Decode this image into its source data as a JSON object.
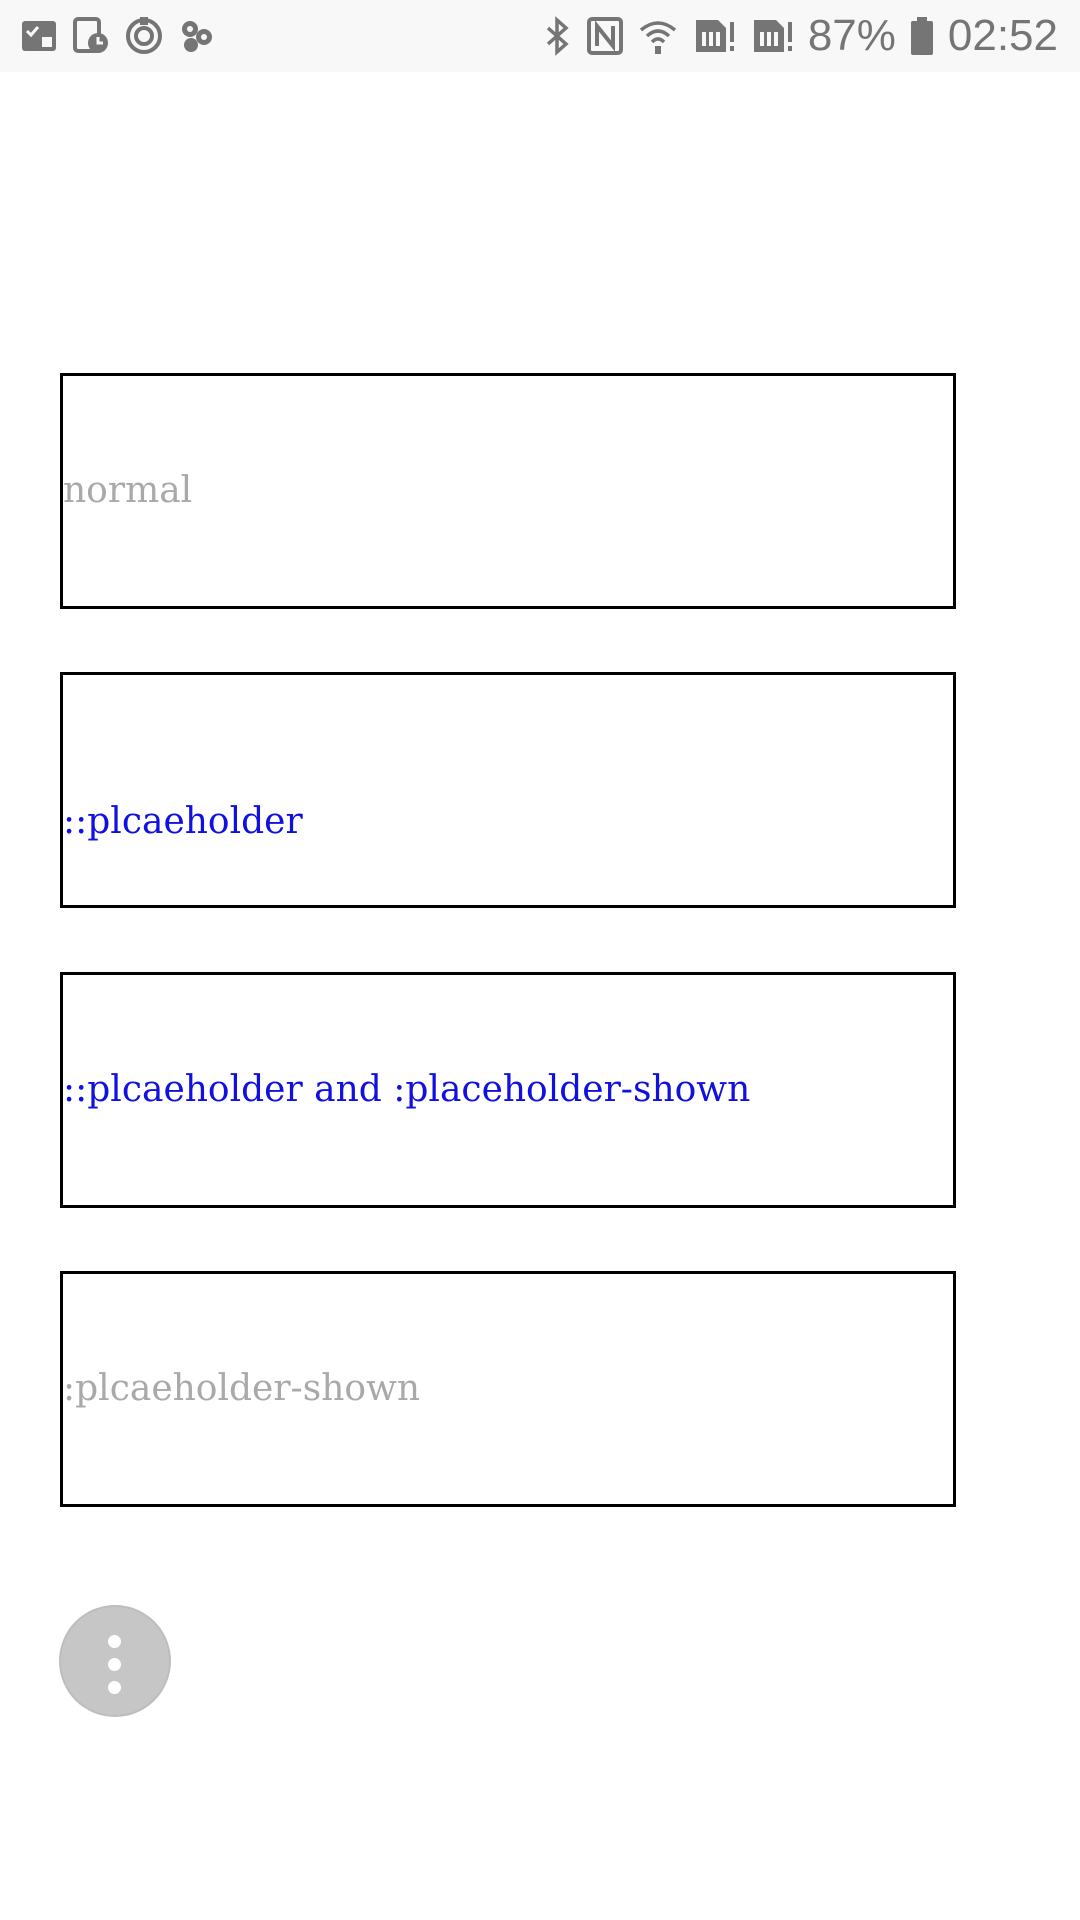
{
  "status_bar": {
    "battery_percent": "87%",
    "time": "02:52",
    "left_icons": [
      "checklist-icon",
      "schedule-icon",
      "sync-icon",
      "gear-icon"
    ],
    "right_icons": [
      "bluetooth-icon",
      "nfc-icon",
      "wifi-icon",
      "sim1-icon",
      "sim2-icon",
      "battery-icon"
    ]
  },
  "fields": [
    {
      "placeholder": "normal",
      "color": "#a9a9a9"
    },
    {
      "placeholder": "::plcaeholder",
      "color": "#1010e0"
    },
    {
      "placeholder": "::plcaeholder and :placeholder-shown",
      "color": "#1010e0"
    },
    {
      "placeholder": ":plcaeholder-shown",
      "color": "#a9a9a9"
    }
  ],
  "fab": {
    "icon": "more-vertical-icon"
  }
}
